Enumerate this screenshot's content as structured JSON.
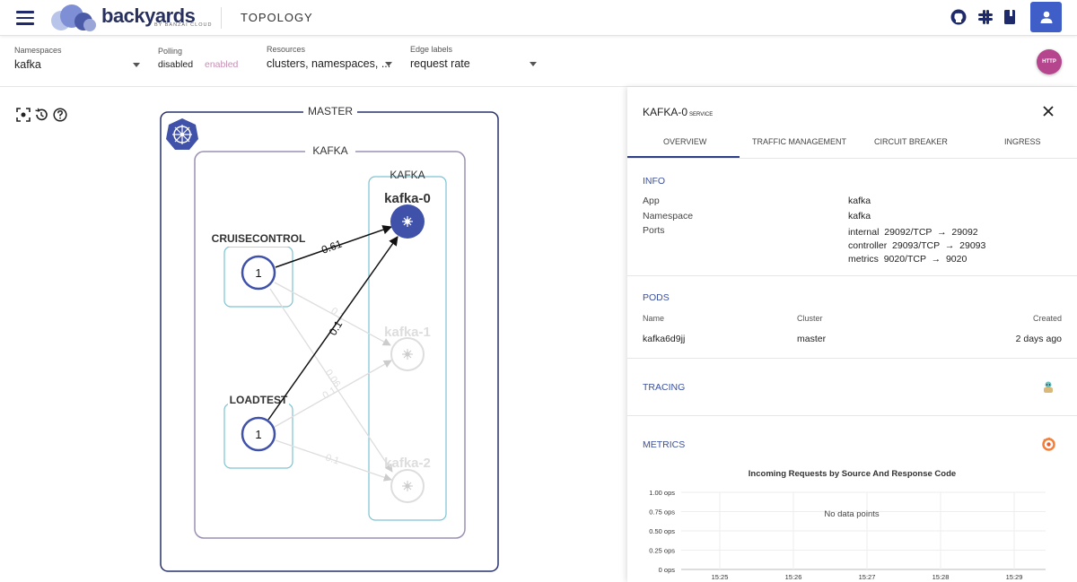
{
  "header": {
    "brand": "backyards",
    "brand_sub": "BY BANZAI CLOUD",
    "section": "TOPOLOGY",
    "icons": [
      "menu-icon",
      "github-icon",
      "slack-icon",
      "book-icon",
      "user-icon"
    ]
  },
  "filters": {
    "namespaces": {
      "label": "Namespaces",
      "value": "kafka"
    },
    "polling": {
      "label": "Polling",
      "disabled": "disabled",
      "enabled": "enabled"
    },
    "resources": {
      "label": "Resources",
      "value": "clusters, namespaces, ..."
    },
    "edge_labels": {
      "label": "Edge labels",
      "value": "request rate"
    },
    "http_badge": "HTTP"
  },
  "graph": {
    "cluster": "MASTER",
    "namespace": "KAFKA",
    "groups": [
      "CRUISECONTROL",
      "LOADTEST",
      "KAFKA"
    ],
    "nodes": {
      "cruisecontrol": "1",
      "loadtest": "1",
      "kafka0": "kafka-0",
      "kafka1": "kafka-1",
      "kafka2": "kafka-2"
    },
    "edges": {
      "cc_k0": "0.61",
      "lt_k0": "0.1",
      "cc_k1": "0.1",
      "cc_k2": "0.06",
      "lt_k1": "0.1",
      "lt_k2": "0.1"
    }
  },
  "panel": {
    "title": "KAFKA-0",
    "title_kind": "SERVICE",
    "tabs": [
      "OVERVIEW",
      "TRAFFIC MANAGEMENT",
      "CIRCUIT BREAKER",
      "INGRESS"
    ],
    "info": {
      "heading": "INFO",
      "app_label": "App",
      "app_value": "kafka",
      "ns_label": "Namespace",
      "ns_value": "kafka",
      "ports_label": "Ports",
      "ports": [
        {
          "name": "internal",
          "port": "29092/TCP",
          "target": "29092"
        },
        {
          "name": "controller",
          "port": "29093/TCP",
          "target": "29093"
        },
        {
          "name": "metrics",
          "port": "9020/TCP",
          "target": "9020"
        }
      ]
    },
    "pods": {
      "heading": "PODS",
      "columns": [
        "Name",
        "Cluster",
        "Created"
      ],
      "rows": [
        [
          "kafka6d9jj",
          "master",
          "2 days ago"
        ]
      ]
    },
    "tracing": {
      "heading": "TRACING"
    },
    "metrics": {
      "heading": "METRICS",
      "chart_title": "Incoming Requests by Source And Response Code",
      "empty": "No data points",
      "y_ticks": [
        "1.00 ops",
        "0.75 ops",
        "0.50 ops",
        "0.25 ops",
        "0 ops"
      ],
      "x_ticks": [
        "15:25",
        "15:26",
        "15:27",
        "15:28",
        "15:29"
      ]
    }
  },
  "colors": {
    "navy": "#27305e",
    "accent": "#3f5ec7",
    "node": "#3f51a8",
    "cluster_border": "#27306b",
    "ns_border": "#9c8fb4",
    "group_border": "#7cc3d3",
    "http": "#b5468e"
  }
}
